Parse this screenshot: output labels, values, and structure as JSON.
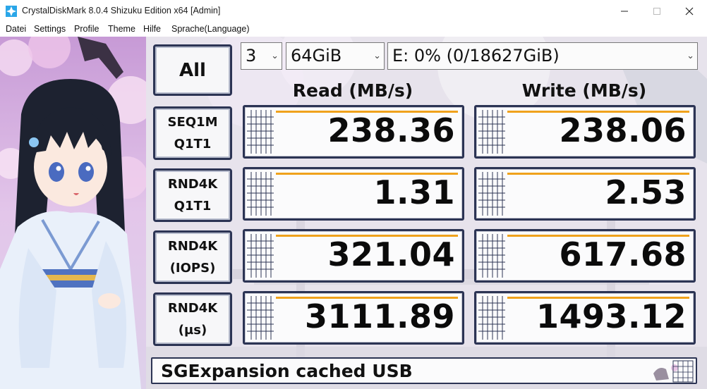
{
  "window": {
    "title": "CrystalDiskMark 8.0.4 Shizuku Edition x64 [Admin]"
  },
  "menu": [
    "Datei",
    "Settings",
    "Profile",
    "Theme",
    "Hilfe",
    "Sprache(Language)"
  ],
  "controls": {
    "all_label": "All",
    "runs": "3",
    "size": "64GiB",
    "drive": "E: 0% (0/18627GiB)"
  },
  "headers": {
    "read": "Read (MB/s)",
    "write": "Write (MB/s)"
  },
  "rows": [
    {
      "line1": "SEQ1M",
      "line2": "Q1T1",
      "read": "238.36",
      "write": "238.06"
    },
    {
      "line1": "RND4K",
      "line2": "Q1T1",
      "read": "1.31",
      "write": "2.53"
    },
    {
      "line1": "RND4K",
      "line2": "(IOPS)",
      "read": "321.04",
      "write": "617.68"
    },
    {
      "line1": "RND4K",
      "line2": "(µs)",
      "read": "3111.89",
      "write": "1493.12"
    }
  ],
  "comment": "SGExpansion cached USB",
  "colors": {
    "frame": "#2c3454",
    "accent_bar": "#f0a21c",
    "app_icon": "#2aa6e8"
  }
}
